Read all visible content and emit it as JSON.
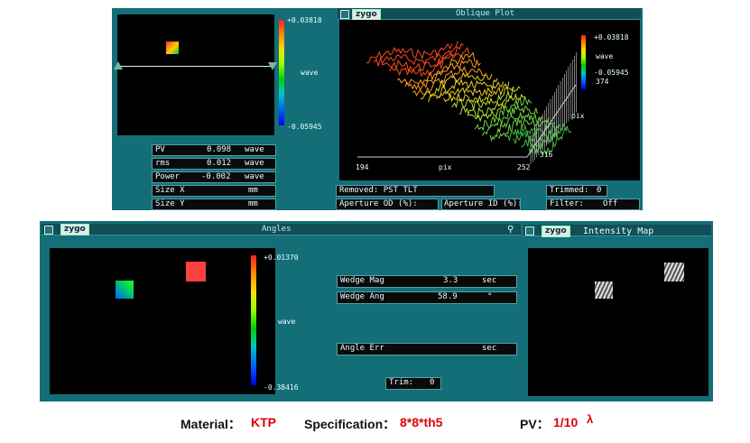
{
  "top_panel": {
    "colorbar_max": "+0.03818",
    "colorbar_unit": "wave",
    "colorbar_min": "-0.05945",
    "stats": [
      {
        "label": "PV",
        "value": "0.098",
        "unit": "wave"
      },
      {
        "label": "rms",
        "value": "0.012",
        "unit": "wave"
      },
      {
        "label": "Power",
        "value": "-0.002",
        "unit": "wave"
      },
      {
        "label": "Size X",
        "value": "",
        "unit": "mm"
      },
      {
        "label": "Size Y",
        "value": "",
        "unit": "mm"
      }
    ],
    "removed": "Removed: PST TLT",
    "trimmed_label": "Trimmed:",
    "trimmed_value": "0",
    "aperture_od": "Aperture OD (%):",
    "aperture_id": "Aperture ID (%):",
    "filter_label": "Filter:",
    "filter_value": "Off"
  },
  "oblique_plot": {
    "brand": "zygo",
    "title": "Oblique Plot",
    "legend_max": "+0.03818",
    "legend_unit": "wave",
    "legend_min": "-0.05945",
    "axis_y_max": "374",
    "axis_y_unit": "pix",
    "axis_y_min": "316",
    "axis_x_min": "194",
    "axis_x_unit": "pix",
    "axis_x_max": "252"
  },
  "angles": {
    "brand": "zygo",
    "title": "Angles",
    "colorbar_max": "+0.01370",
    "colorbar_unit": "wave",
    "colorbar_min": "-0.38416",
    "wedge_mag_label": "Wedge Mag",
    "wedge_mag_value": "3.3",
    "wedge_mag_unit": "sec",
    "wedge_ang_label": "Wedge Ang",
    "wedge_ang_value": "58.9",
    "wedge_ang_unit": "°",
    "angle_err_label": "Angle Err",
    "angle_err_unit": "sec",
    "trim_label": "Trim:",
    "trim_value": "0"
  },
  "intensity": {
    "brand": "zygo",
    "title": "Intensity Map"
  },
  "caption": {
    "material_label": "Material：",
    "material_value": "KTP",
    "spec_label": "Specification：",
    "spec_value": "8*8*th5",
    "pv_label": "PV：",
    "pv_value": "1/10",
    "lambda": "λ"
  },
  "colors": {
    "panel_teal": "#146e78",
    "accent_red": "#e00000"
  }
}
